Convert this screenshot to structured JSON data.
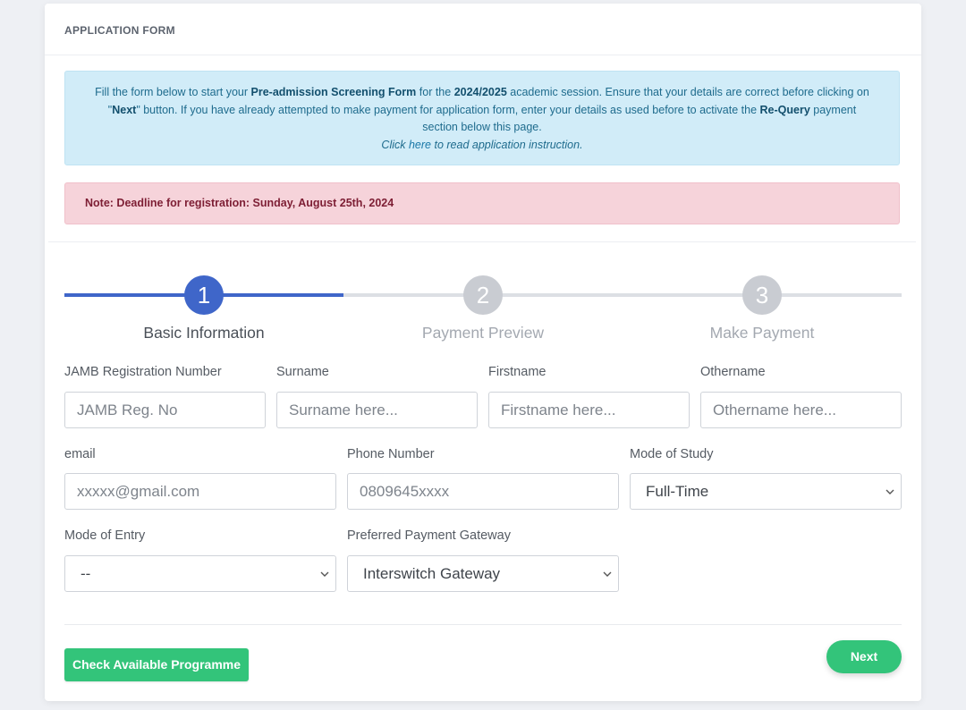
{
  "header": {
    "title": "APPLICATION FORM"
  },
  "info": {
    "t1": "Fill the form below to start your ",
    "b1": "Pre-admission Screening Form",
    "t2": " for the ",
    "b2": "2024/2025",
    "t3": " academic session. Ensure that your details are correct before clicking on \"",
    "b3": "Next",
    "t4": "\" button. If you have already attempted to make payment for application form, enter your details as used before to activate the ",
    "b4": "Re-Query",
    "t5": " payment section below this page.",
    "click": "Click ",
    "here": "here",
    "instruction": " to read application instruction."
  },
  "note": {
    "text": "Note: Deadline for registration: Sunday, August 25th, 2024"
  },
  "steps": [
    {
      "number": "1",
      "label": "Basic Information"
    },
    {
      "number": "2",
      "label": "Payment Preview"
    },
    {
      "number": "3",
      "label": "Make Payment"
    }
  ],
  "form": {
    "jamb": {
      "label": "JAMB Registration Number",
      "placeholder": "JAMB Reg. No"
    },
    "surname": {
      "label": "Surname",
      "placeholder": "Surname here..."
    },
    "firstname": {
      "label": "Firstname",
      "placeholder": "Firstname here..."
    },
    "othername": {
      "label": "Othername",
      "placeholder": "Othername here..."
    },
    "email": {
      "label": "email",
      "placeholder": "xxxxx@gmail.com"
    },
    "phone": {
      "label": "Phone Number",
      "placeholder": "0809645xxxx"
    },
    "mode_of_study": {
      "label": "Mode of Study",
      "value": "Full-Time"
    },
    "mode_of_entry": {
      "label": "Mode of Entry",
      "value": "--"
    },
    "gateway": {
      "label": "Preferred Payment Gateway",
      "value": "Interswitch Gateway"
    }
  },
  "buttons": {
    "check": "Check Available Programme",
    "next": "Next"
  },
  "colors": {
    "primary": "#3f66c9",
    "success": "#33c47a",
    "info_bg": "#d1ecf8",
    "danger_bg": "#f6d3da",
    "step_inactive": "#c9ccd2"
  }
}
